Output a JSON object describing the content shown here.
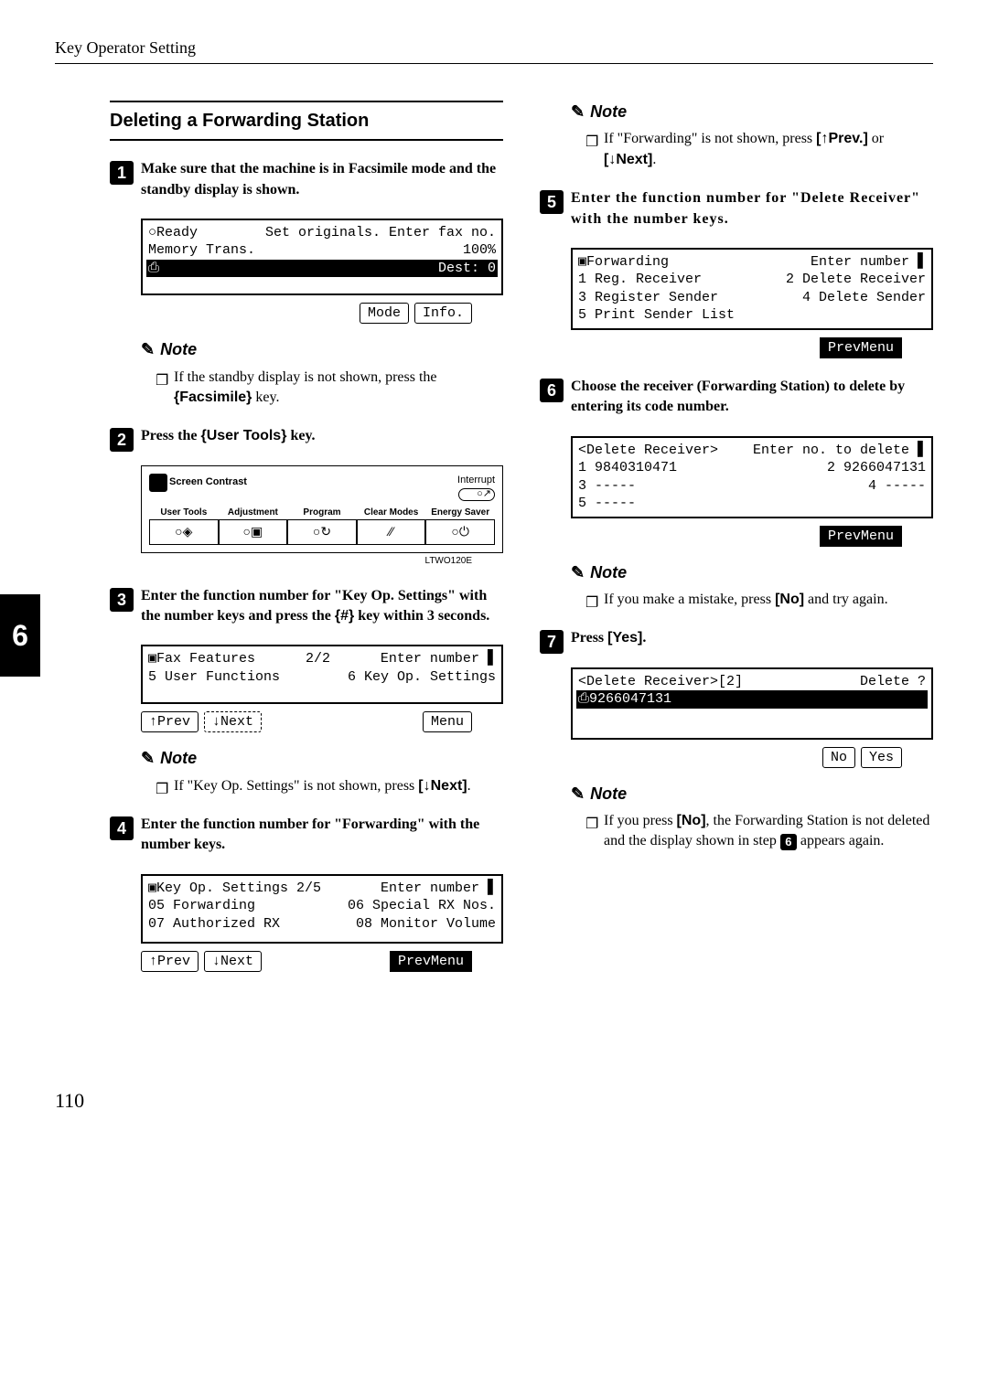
{
  "header": {
    "title": "Key Operator Setting"
  },
  "sideTab": "6",
  "pageNumber": "110",
  "left": {
    "sectionHeading": "Deleting a Forwarding Station",
    "step1": {
      "num": "1",
      "text": "Make sure that the machine is in Facsimile mode and the standby display is shown."
    },
    "screenA": {
      "row1_left": "○Ready",
      "row1_right": "Set originals. Enter fax no.",
      "row2_left": "Memory Trans.",
      "row2_right": "100%",
      "row3_left": "⎙",
      "row3_right": "Dest:  0",
      "btn1": "Mode",
      "btn2": "Info."
    },
    "noteA": {
      "title": "Note",
      "bullet": "❐",
      "text_a": "If the standby display is not shown, press the ",
      "key": "Facsimile",
      "text_b": " key."
    },
    "step2": {
      "num": "2",
      "text_a": "Press the ",
      "key": "User Tools",
      "text_b": " key."
    },
    "panel": {
      "contrast": "Screen Contrast",
      "interrupt": "Interrupt",
      "labels": [
        "User Tools",
        "Adjustment",
        "Program",
        "Clear Modes",
        "Energy Saver"
      ],
      "caption": "LTWO120E",
      "icon_usertools": "◈",
      "icon_adjust": "▣",
      "icon_program": "↻",
      "icon_clear": "⁄⁄",
      "icon_energy": "⏻"
    },
    "step3": {
      "num": "3",
      "text_a": "Enter the function number for \"Key Op. Settings\" with the number keys and press the ",
      "key": "#",
      "text_b": " key within 3 seconds."
    },
    "screenB": {
      "row1_left": "▣Fax Features",
      "row1_mid": "2/2",
      "row1_right": "Enter number ▋",
      "row2_left": "5 User Functions",
      "row2_right": "6 Key Op. Settings",
      "btnPrev": "↑Prev",
      "btnNext": "↓Next",
      "btnMenu": "Menu"
    },
    "noteB": {
      "title": "Note",
      "bullet": "❐",
      "text_a": "If \"Key Op. Settings\" is not shown, press ",
      "key": "[↓Next]",
      "text_b": "."
    },
    "step4": {
      "num": "4",
      "text": "Enter the function number for \"Forwarding\" with the number keys."
    },
    "screenC": {
      "row1_left": "▣Key Op. Settings 2/5",
      "row1_right": "Enter number ▋",
      "row2_left": "05 Forwarding",
      "row2_right": "06 Special RX Nos.",
      "row3_left": "07 Authorized RX",
      "row3_right": "08 Monitor Volume",
      "btnPrev": "↑Prev",
      "btnNext": "↓Next",
      "btnMenu": "PrevMenu"
    }
  },
  "right": {
    "noteC": {
      "title": "Note",
      "bullet": "❐",
      "text_a": "If \"Forwarding\" is not shown, press ",
      "key1": "[↑Prev.]",
      "mid": " or ",
      "key2": "[↓Next]",
      "text_b": "."
    },
    "step5": {
      "num": "5",
      "text": "Enter the function number for \"Delete Receiver\" with the number keys."
    },
    "screenD": {
      "row1_left": "▣Forwarding",
      "row1_right": "Enter number ▋",
      "row2_left": "1 Reg. Receiver",
      "row2_right": "2 Delete Receiver",
      "row3_left": "3 Register Sender",
      "row3_right": "4 Delete Sender",
      "row4_left": "5 Print Sender List",
      "row4_right": "",
      "btnMenu": "PrevMenu"
    },
    "step6": {
      "num": "6",
      "text": "Choose the receiver (Forwarding Station) to delete by entering its code number."
    },
    "screenE": {
      "row1_left": "<Delete Receiver>",
      "row1_right": "Enter no. to delete ▋",
      "row2_left": "1 9840310471",
      "row2_right": "2 9266047131",
      "row3_left": "3 -----",
      "row3_right": "4 -----",
      "row4_left": "5 -----",
      "row4_right": "",
      "btnMenu": "PrevMenu"
    },
    "noteD": {
      "title": "Note",
      "bullet": "❐",
      "text_a": "If you make a mistake, press ",
      "key": "[No]",
      "text_b": " and try again."
    },
    "step7": {
      "num": "7",
      "text_a": "Press ",
      "key": "[Yes]",
      "text_b": "."
    },
    "screenF": {
      "row1_left": "<Delete Receiver>[2]",
      "row1_right": "Delete ?",
      "row2_left": "⎙9266047131",
      "row2_right": "",
      "btnNo": "No",
      "btnYes": "Yes"
    },
    "noteE": {
      "title": "Note",
      "bullet": "❐",
      "text_a": "If you press ",
      "key": "[No]",
      "text_b": ", the Forwarding Station is not deleted and the display shown in step ",
      "stepref": "6",
      "text_c": " appears again."
    }
  }
}
